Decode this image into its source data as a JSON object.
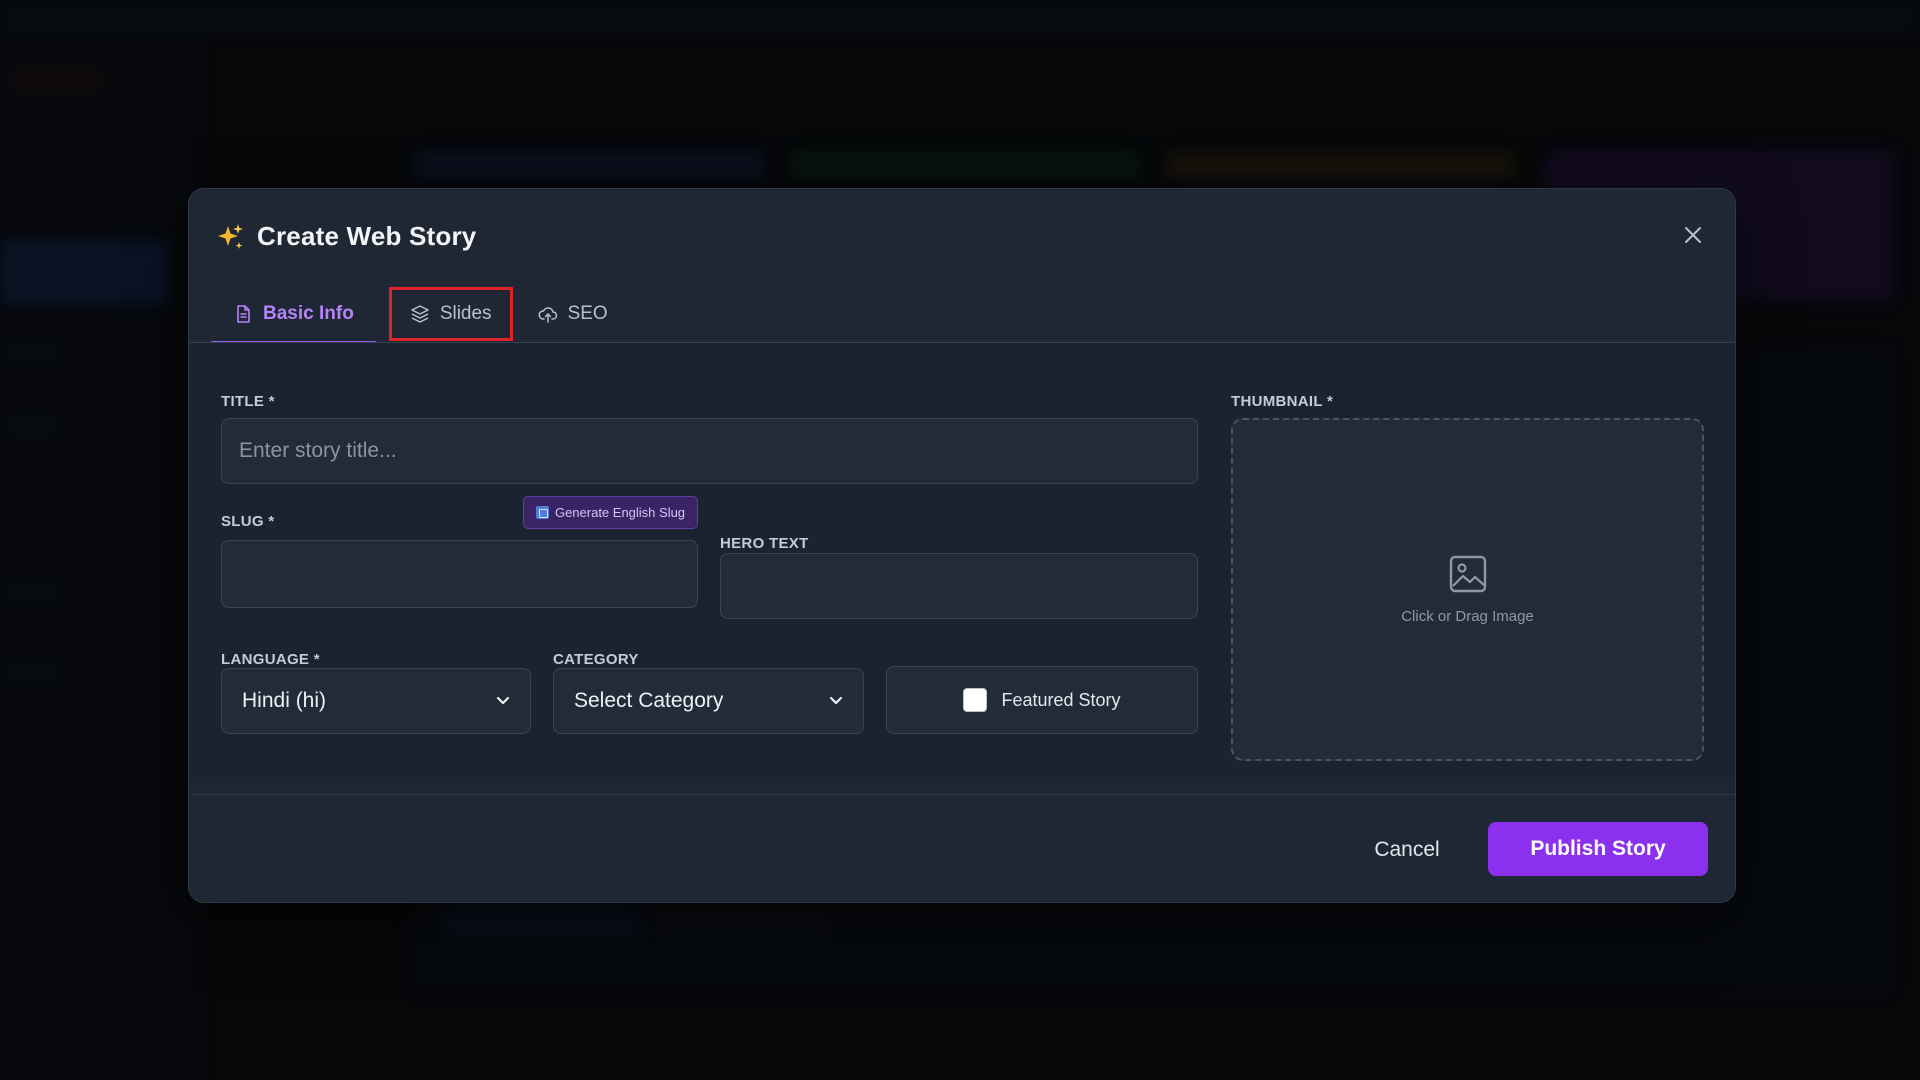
{
  "modal": {
    "title": "Create Web Story",
    "title_icon": "sparkles-icon",
    "close_icon": "close-icon"
  },
  "tabs": [
    {
      "label": "Basic Info",
      "icon": "document-icon",
      "active": true
    },
    {
      "label": "Slides",
      "icon": "layers-icon",
      "active": false,
      "highlighted": true
    },
    {
      "label": "SEO",
      "icon": "cloud-upload-icon",
      "active": false
    }
  ],
  "form": {
    "title": {
      "label": "TITLE *",
      "value": "",
      "placeholder": "Enter story title..."
    },
    "slug": {
      "label": "SLUG *",
      "value": "",
      "generate_button": "Generate English Slug"
    },
    "hero_text": {
      "label": "HERO TEXT",
      "value": ""
    },
    "language": {
      "label": "LANGUAGE *",
      "selected": "Hindi (hi)"
    },
    "category": {
      "label": "CATEGORY",
      "selected": "Select Category"
    },
    "featured": {
      "label": "Featured Story",
      "checked": false
    },
    "thumbnail": {
      "label": "THUMBNAIL *",
      "dropzone_text": "Click or Drag Image",
      "icon": "image-icon"
    }
  },
  "footer": {
    "cancel_label": "Cancel",
    "publish_label": "Publish Story"
  },
  "colors": {
    "accent": "#8a30ee",
    "tab_active": "#b583f7",
    "highlight_outline": "#e0222a",
    "modal_bg": "#1e2633"
  }
}
